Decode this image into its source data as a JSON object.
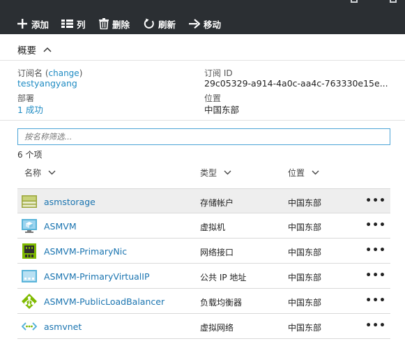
{
  "toolbar": {
    "add": "添加",
    "columns": "列",
    "delete": "删除",
    "refresh": "刷新",
    "move": "移动"
  },
  "essentials": {
    "title": "概要",
    "subscription_label": "订阅名",
    "change_link": "change",
    "subscription_name": "testyangyang",
    "subscription_id_label": "订阅 ID",
    "subscription_id": "29c05329-a914-4a0c-aa4c-763330e15e...",
    "deployments_label": "部署",
    "deployments_value": "1 成功",
    "location_label": "位置",
    "location_value": "中国东部"
  },
  "filter": {
    "placeholder": "按名称筛选..."
  },
  "count_label": "6 个项",
  "columns": {
    "name": "名称",
    "type": "类型",
    "location": "位置"
  },
  "resources": [
    {
      "name": "asmstorage",
      "type": "存储帐户",
      "location": "中国东部",
      "icon": "storage-account-icon",
      "selected": true
    },
    {
      "name": "ASMVM",
      "type": "虚拟机",
      "location": "中国东部",
      "icon": "virtual-machine-icon",
      "selected": false
    },
    {
      "name": "ASMVM-PrimaryNic",
      "type": "网络接口",
      "location": "中国东部",
      "icon": "network-interface-icon",
      "selected": false
    },
    {
      "name": "ASMVM-PrimaryVirtualIP",
      "type": "公共 IP 地址",
      "location": "中国东部",
      "icon": "public-ip-icon",
      "selected": false
    },
    {
      "name": "ASMVM-PublicLoadBalancer",
      "type": "负载均衡器",
      "location": "中国东部",
      "icon": "load-balancer-icon",
      "selected": false
    },
    {
      "name": "asmvnet",
      "type": "虚拟网络",
      "location": "中国东部",
      "icon": "virtual-network-icon",
      "selected": false
    }
  ],
  "more_label": "•••"
}
